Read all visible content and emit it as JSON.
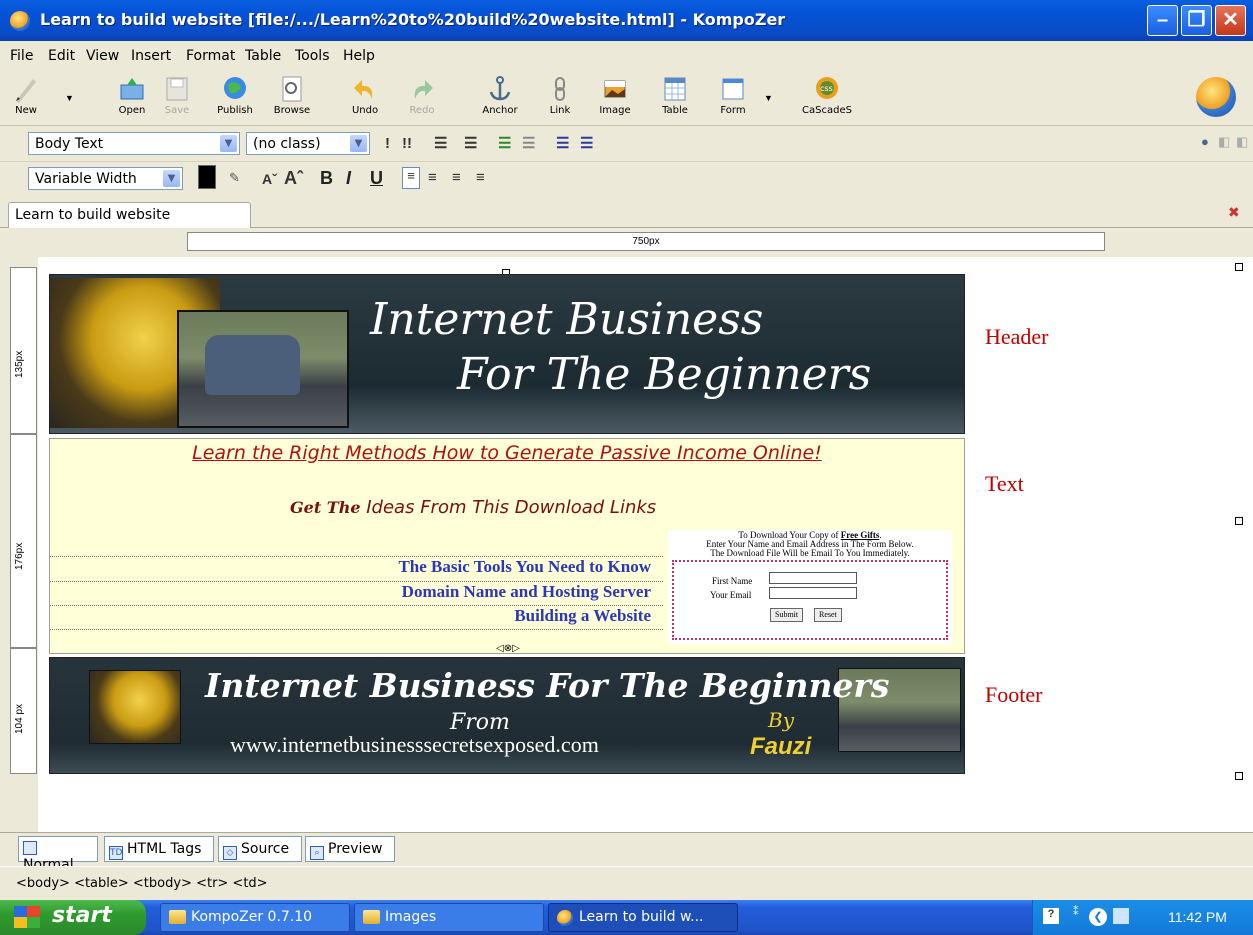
{
  "window": {
    "title": "Learn to build website [file:/.../Learn%20to%20build%20website.html] - KompoZer"
  },
  "menu": [
    "File",
    "Edit",
    "View",
    "Insert",
    "Format",
    "Table",
    "Tools",
    "Help"
  ],
  "toolbar": [
    {
      "label": "New",
      "icon": "new-doc-icon",
      "enabled": true
    },
    {
      "label": "Open",
      "icon": "open-icon",
      "enabled": true
    },
    {
      "label": "Save",
      "icon": "save-icon",
      "enabled": false
    },
    {
      "label": "Publish",
      "icon": "publish-icon",
      "enabled": true
    },
    {
      "label": "Browse",
      "icon": "browse-icon",
      "enabled": true
    },
    {
      "label": "Undo",
      "icon": "undo-icon",
      "enabled": true
    },
    {
      "label": "Redo",
      "icon": "redo-icon",
      "enabled": false
    },
    {
      "label": "Anchor",
      "icon": "anchor-icon",
      "enabled": true
    },
    {
      "label": "Link",
      "icon": "link-icon",
      "enabled": true
    },
    {
      "label": "Image",
      "icon": "image-icon",
      "enabled": true
    },
    {
      "label": "Table",
      "icon": "table-icon",
      "enabled": true
    },
    {
      "label": "Form",
      "icon": "form-icon",
      "enabled": true
    },
    {
      "label": "CaScadeS",
      "icon": "css-icon",
      "enabled": true
    }
  ],
  "format": {
    "paragraph_style": "Body Text",
    "class": "(no class)",
    "font": "Variable Width"
  },
  "doc_tab": "Learn to build website",
  "ruler": {
    "width_label": "750px",
    "rows": [
      "135px",
      "176px",
      "104 px"
    ]
  },
  "page": {
    "header_line1": "Internet Business",
    "header_line2": "For The Beginners",
    "tagline": "Learn the Right Methods How to Generate Passive Income Online!",
    "ideas_bold": "Get The",
    "ideas_rest": " Ideas From This Download Links",
    "links": [
      "The Basic Tools You Need to Know",
      "Domain Name and Hosting Server",
      "Building a Website"
    ],
    "form": {
      "line1": "To Download Your Copy of",
      "line1_link": "Free Gifts",
      "line2": "Enter Your Name and Email Address in The Form Below.",
      "line3": "The Download File Will be Email To You Immediately.",
      "first_name": "First Name",
      "email": "Your Email",
      "submit": "Submit",
      "reset": "Reset"
    },
    "footer_title": "Internet Business For The Beginners",
    "footer_from": "From",
    "footer_url": "www.internetbusinesssecretsexposed.com",
    "footer_by": "By",
    "footer_name": "Fauzi"
  },
  "annotations": {
    "header": "Header",
    "text": "Text",
    "footer": "Footer"
  },
  "modes": [
    "Normal",
    "HTML Tags",
    "Source",
    "Preview"
  ],
  "breadcrumb": "<body> <table> <tbody> <tr> <td>",
  "taskbar": {
    "start": "start",
    "tasks": [
      "KompoZer 0.7.10",
      "Images",
      "Learn to build w..."
    ],
    "clock": "11:42 PM"
  }
}
